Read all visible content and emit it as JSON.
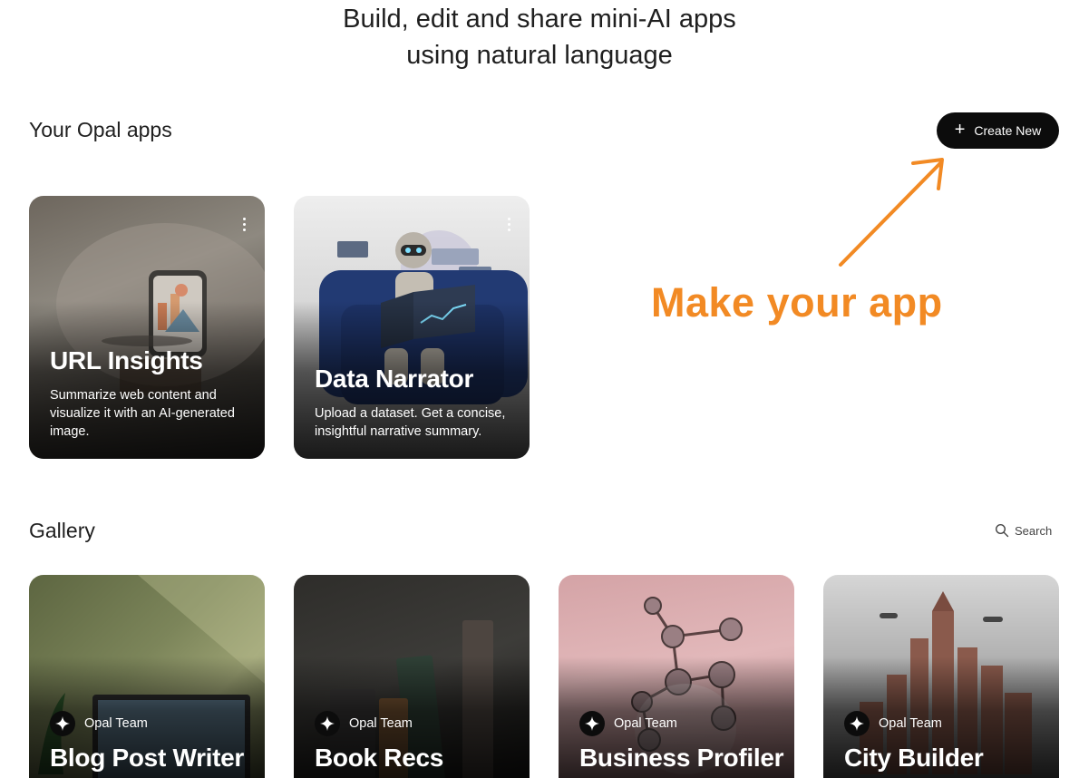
{
  "hero": {
    "line1": "Build, edit and share mini-AI apps",
    "line2": "using natural language"
  },
  "your_apps": {
    "heading": "Your Opal apps",
    "create_button": {
      "label": "Create New",
      "icon": "plus-icon"
    },
    "cards": [
      {
        "title": "URL Insights",
        "description": "Summarize web content and visualize it with an AI-generated image.",
        "menu_icon": "more-vert-icon"
      },
      {
        "title": "Data Narrator",
        "description": "Upload a dataset. Get a concise, insightful narrative summary.",
        "menu_icon": "more-vert-icon"
      }
    ]
  },
  "annotation": {
    "text": "Make your app",
    "color": "#f28a24"
  },
  "gallery": {
    "heading": "Gallery",
    "search_label": "Search",
    "cards": [
      {
        "author": "Opal Team",
        "title": "Blog Post Writer"
      },
      {
        "author": "Opal Team",
        "title": "Book Recs"
      },
      {
        "author": "Opal Team",
        "title": "Business Profiler"
      },
      {
        "author": "Opal Team",
        "title": "City Builder"
      }
    ]
  },
  "colors": {
    "button_bg": "#0c0c0c",
    "accent_annotation": "#f28a24",
    "background": "#ffffff"
  }
}
